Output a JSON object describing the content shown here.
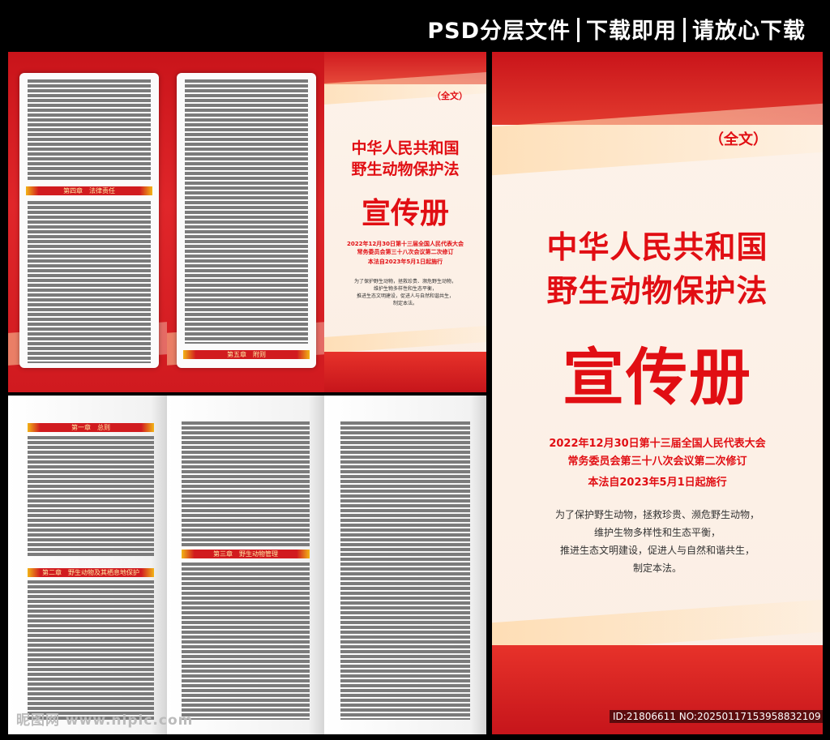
{
  "header": {
    "part1": "PSD分层文件",
    "part2": "下载即用",
    "part3": "请放心下载"
  },
  "cover": {
    "tag": "（全文）",
    "title_line1": "中华人民共和国",
    "title_line2": "野生动物保护法",
    "big_title": "宣传册",
    "sub1": "2022年12月30日第十三届全国人民代表大会",
    "sub2": "常务委员会第三十八次会议第二次修订",
    "sub3": "本法自2023年5月1日起施行",
    "body1": "为了保护野生动物，拯救珍贵、濒危野生动物，",
    "body2": "维护生物多样性和生态平衡，",
    "body3": "推进生态文明建设，促进人与自然和谐共生，",
    "body4": "制定本法。"
  },
  "chapters": {
    "ch1": "第一章　总则",
    "ch2": "第二章　野生动物及其栖息地保护",
    "ch3": "第三章　野生动物管理",
    "ch4": "第四章　法律责任",
    "ch5": "第五章　附则"
  },
  "watermark": "昵图网 www.nipic.com",
  "id_text": "ID:21806611 NO:20250117153958832109",
  "colors": {
    "red": "#d11b1f",
    "gold": "#f2b416",
    "cream": "#fdf3ea"
  }
}
